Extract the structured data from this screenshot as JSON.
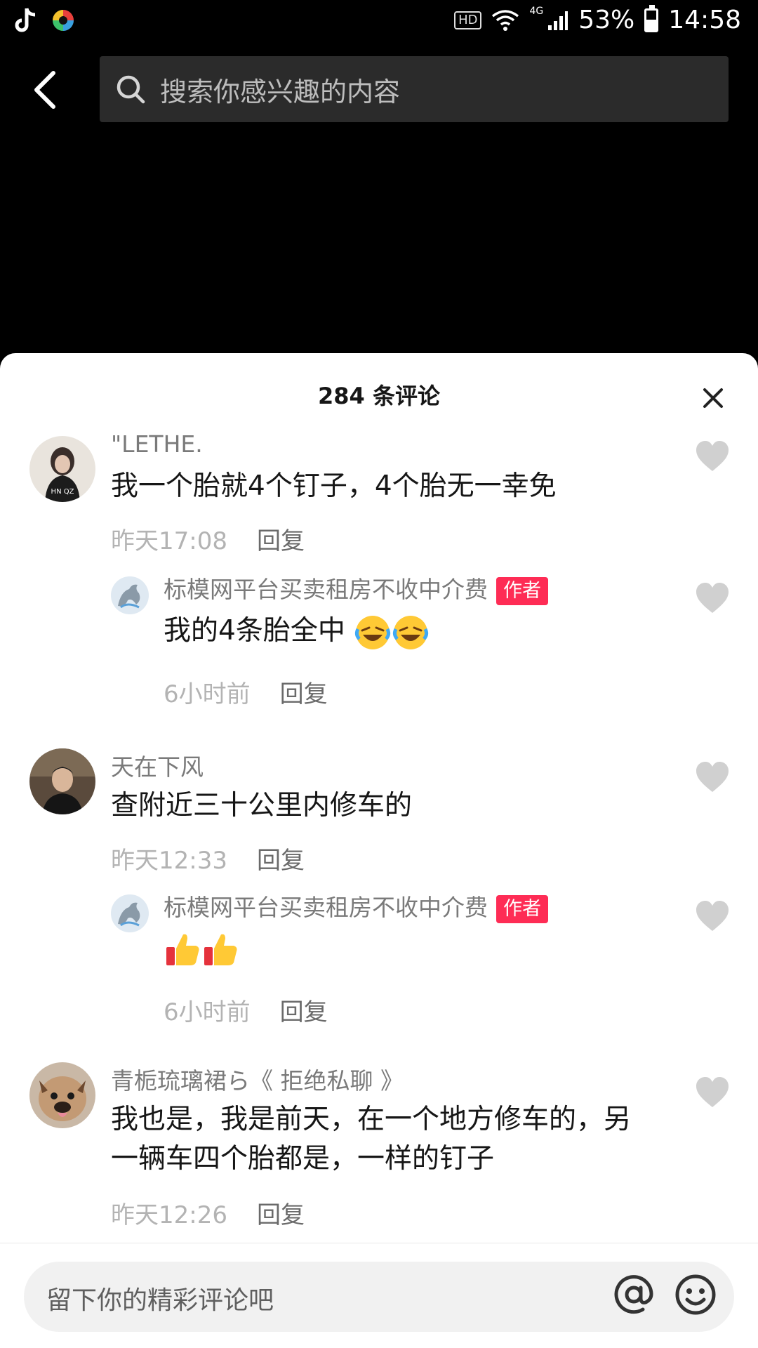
{
  "status_bar": {
    "hd": "HD",
    "network": "4G",
    "battery_percent": "53%",
    "battery_level": 0.53,
    "time": "14:58"
  },
  "header": {
    "search_placeholder": "搜索你感兴趣的内容"
  },
  "comments_panel": {
    "title": "284 条评论",
    "comments": [
      {
        "username": "\"LETHE.",
        "text": "我一个胎就4个钉子，4个胎无一幸免",
        "time": "昨天17:08",
        "reply_label": "回复",
        "reply": {
          "username": "标模网平台买卖租房不收中介费",
          "badge": "作者",
          "text": "我的4条胎全中",
          "emojis": [
            "rolling-laughing-emoji",
            "rolling-laughing-emoji"
          ],
          "time": "6小时前",
          "reply_label": "回复"
        }
      },
      {
        "username": "天在下风",
        "text": "查附近三十公里内修车的",
        "time": "昨天12:33",
        "reply_label": "回复",
        "reply": {
          "username": "标模网平台买卖租房不收中介费",
          "badge": "作者",
          "text": "",
          "emojis": [
            "thumbs-up-emoji",
            "thumbs-up-emoji"
          ],
          "time": "6小时前",
          "reply_label": "回复"
        }
      },
      {
        "username": "青栀琉璃裙ら《 拒绝私聊 》",
        "text_line1": "我也是，我是前天，在一个地方修车的，另",
        "text_line2": "一辆车四个胎都是，一样的钉子",
        "time": "昨天12:26",
        "reply_label": "回复"
      }
    ]
  },
  "input_bar": {
    "placeholder": "留下你的精彩评论吧"
  },
  "colors": {
    "background": "#000000",
    "sheet": "#ffffff",
    "author_badge": "#fe2c55",
    "like_icon": "#d0d0d0"
  }
}
